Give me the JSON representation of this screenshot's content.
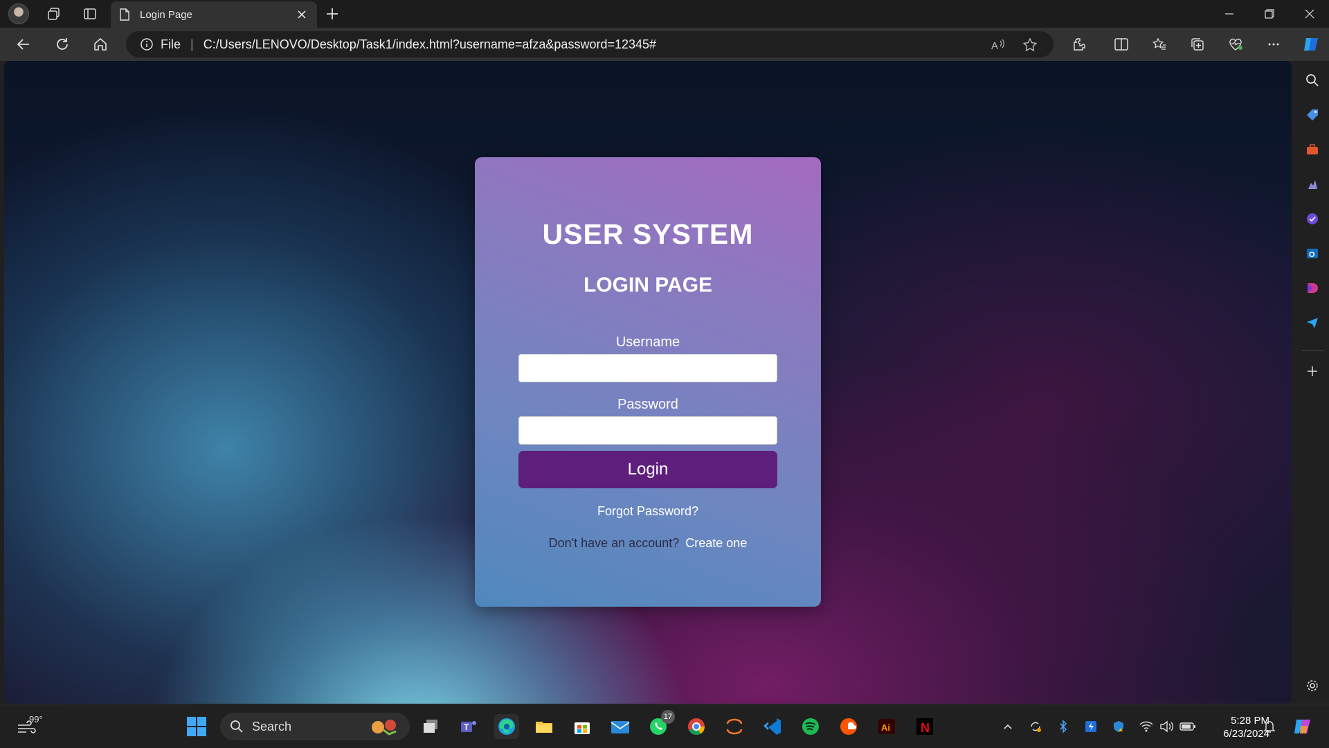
{
  "browser": {
    "tab_title": "Login Page",
    "address_scheme_label": "File",
    "address_url": "C:/Users/LENOVO/Desktop/Task1/index.html?username=afza&password=12345#"
  },
  "page": {
    "title": "USER SYSTEM",
    "subtitle": "LOGIN PAGE",
    "username_label": "Username",
    "username_value": "",
    "password_label": "Password",
    "password_value": "",
    "login_button": "Login",
    "forgot_link": "Forgot Password?",
    "signup_prompt": "Don't have an account?",
    "signup_link": "Create one",
    "colors": {
      "button": "#5e1f7c",
      "card_top": "#a46ac0",
      "card_bottom": "#4f88bd"
    }
  },
  "taskbar": {
    "weather": "99°",
    "search_placeholder": "Search",
    "whatsapp_badge": "17",
    "time": "5:28 PM",
    "date": "6/23/2024"
  },
  "icons": {
    "sidebar": [
      "search-icon",
      "shopping-tag-icon",
      "toolbox-icon",
      "games-icon",
      "copilot-icon",
      "outlook-icon",
      "designer-icon",
      "send-icon",
      "add-icon",
      "settings-icon"
    ]
  }
}
